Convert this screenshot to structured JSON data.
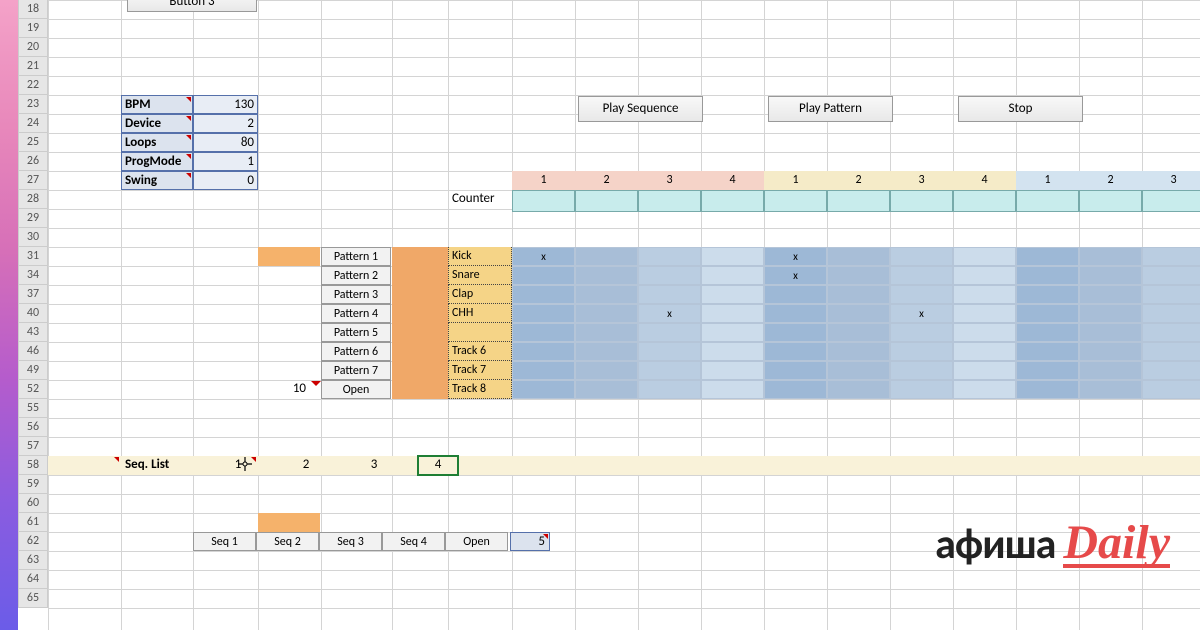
{
  "row_headers": [
    "18",
    "19",
    "20",
    "21",
    "22",
    "23",
    "24",
    "25",
    "26",
    "27",
    "28",
    "29",
    "30",
    "31",
    "34",
    "37",
    "40",
    "43",
    "46",
    "49",
    "52",
    "55",
    "56",
    "57",
    "58",
    "59",
    "60",
    "61",
    "62",
    "63",
    "64",
    "65"
  ],
  "button3": "Button 3",
  "params": [
    {
      "l": "BPM",
      "v": "130"
    },
    {
      "l": "Device",
      "v": "2"
    },
    {
      "l": "Loops",
      "v": "80"
    },
    {
      "l": "ProgMode",
      "v": "1"
    },
    {
      "l": "Swing",
      "v": "0"
    }
  ],
  "play_seq": "Play Sequence",
  "play_pat": "Play Pattern",
  "stop": "Stop",
  "beat_nums": [
    "1",
    "2",
    "3",
    "4",
    "1",
    "2",
    "3",
    "4",
    "1",
    "2",
    "3"
  ],
  "counter_lbl": "Counter",
  "patterns": [
    "Pattern 1",
    "Pattern 2",
    "Pattern 3",
    "Pattern 4",
    "Pattern 5",
    "Pattern 6",
    "Pattern 7"
  ],
  "open": "Open",
  "ten": "10",
  "tracks": [
    "Kick",
    "Snare",
    "Clap",
    "CHH",
    "",
    "Track 6",
    "Track 7",
    "Track 8"
  ],
  "grid": [
    [
      "x",
      "",
      "",
      "",
      "x",
      "",
      "",
      "",
      "",
      "",
      ""
    ],
    [
      "",
      "",
      "",
      "",
      "x",
      "",
      "",
      "",
      "",
      "",
      ""
    ],
    [
      "",
      "",
      "",
      "",
      "",
      "",
      "",
      "",
      "",
      "",
      ""
    ],
    [
      "",
      "",
      "x",
      "",
      "",
      "",
      "x",
      "",
      "",
      "",
      ""
    ],
    [
      "",
      "",
      "",
      "",
      "",
      "",
      "",
      "",
      "",
      "",
      ""
    ],
    [
      "",
      "",
      "",
      "",
      "",
      "",
      "",
      "",
      "",
      "",
      ""
    ],
    [
      "",
      "",
      "",
      "",
      "",
      "",
      "",
      "",
      "",
      "",
      ""
    ],
    [
      "",
      "",
      "",
      "",
      "",
      "",
      "",
      "",
      "",
      "",
      ""
    ]
  ],
  "seq_list_lbl": "Seq. List",
  "seq_list": [
    "1",
    "2",
    "3",
    "4"
  ],
  "seqs": [
    "Seq 1",
    "Seq 2",
    "Seq 3",
    "Seq 4",
    "Open"
  ],
  "seq_val": "5",
  "logo_a": "афиша",
  "logo_d": "Daily"
}
